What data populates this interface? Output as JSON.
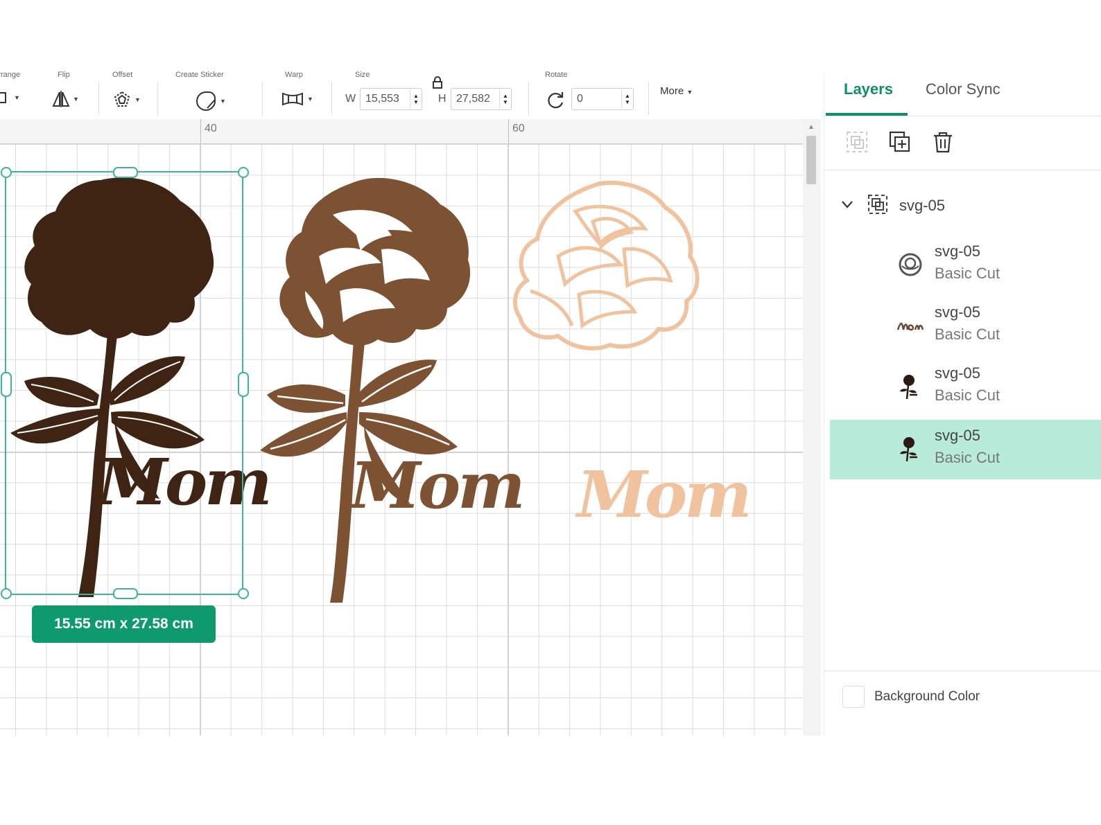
{
  "toolbar": {
    "arrange_label": "Arrange",
    "flip_label": "Flip",
    "offset_label": "Offset",
    "sticker_label": "Create Sticker",
    "warp_label": "Warp",
    "size_label": "Size",
    "rotate_label": "Rotate",
    "width_prefix": "W",
    "width_value": "15,553",
    "height_prefix": "H",
    "height_value": "27,582",
    "rotate_value": "0",
    "more_label": "More"
  },
  "ruler": {
    "mark_40": "40",
    "mark_60": "60"
  },
  "canvas": {
    "selection_size": "15.55  cm x 27.58  cm",
    "art_text": "Mom",
    "colors": {
      "dark_rose": "#3f2414",
      "mid_rose": "#7c5233",
      "light_rose": "#f0c29e",
      "selection": "#3db59a"
    }
  },
  "panel": {
    "tabs": [
      {
        "label": "Layers"
      },
      {
        "label": "Color Sync"
      }
    ],
    "group_name": "svg-05",
    "layers": [
      {
        "name": "svg-05",
        "operation": "Basic Cut"
      },
      {
        "name": "svg-05",
        "operation": "Basic Cut"
      },
      {
        "name": "svg-05",
        "operation": "Basic Cut"
      },
      {
        "name": "svg-05",
        "operation": "Basic Cut"
      }
    ],
    "background_color_label": "Background Color",
    "accent": "#0e8f65",
    "selected_row": "#b9ebdb"
  },
  "icons": [
    "arrange-icon",
    "flip-icon",
    "offset-icon",
    "sticker-icon",
    "warp-icon",
    "lock-icon",
    "rotate-icon",
    "caret-icon",
    "group-icon",
    "duplicate-icon",
    "trash-icon",
    "chevron-down-icon"
  ]
}
